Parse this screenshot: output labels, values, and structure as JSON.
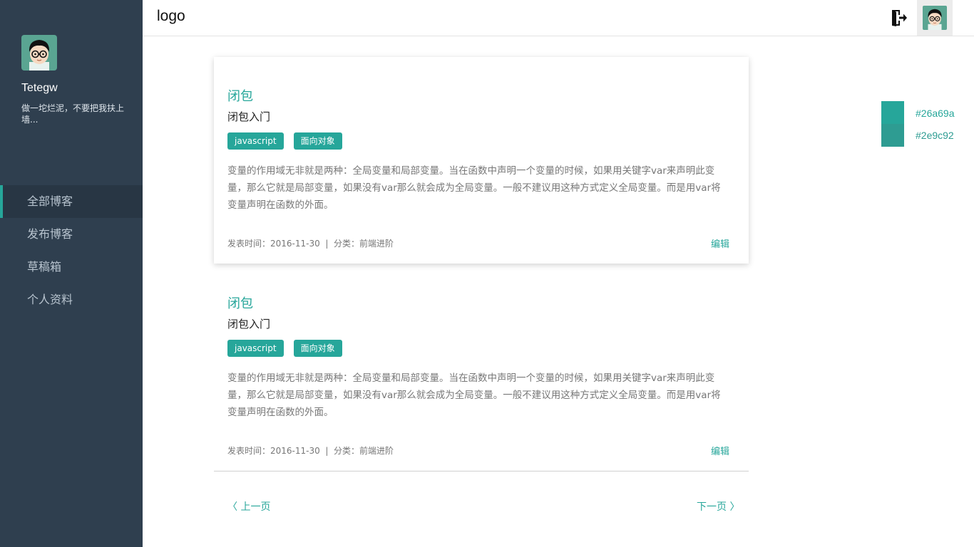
{
  "sidebar": {
    "name": "Tetegw",
    "motto": "做一坨烂泥，不要把我扶上墙...",
    "items": [
      {
        "label": "全部博客"
      },
      {
        "label": "发布博客"
      },
      {
        "label": "草稿箱"
      },
      {
        "label": "个人资料"
      }
    ]
  },
  "header": {
    "logo": "logo"
  },
  "articles": [
    {
      "title": "闭包",
      "subtitle": "闭包入门",
      "tags": [
        "javascript",
        "面向对象"
      ],
      "body": "变量的作用域无非就是两种：全局变量和局部变量。当在函数中声明一个变量的时候，如果用关键字var来声明此变量，那么它就是局部变量，如果没有var那么就会成为全局变量。一般不建议用这种方式定义全局变量。而是用var将变量声明在函数的外面。",
      "meta": "发表时间：2016-11-30  |  分类：前端进阶",
      "edit": "编辑"
    },
    {
      "title": "闭包",
      "subtitle": "闭包入门",
      "tags": [
        "javascript",
        "面向对象"
      ],
      "body": "变量的作用域无非就是两种：全局变量和局部变量。当在函数中声明一个变量的时候，如果用关键字var来声明此变量，那么它就是局部变量，如果没有var那么就会成为全局变量。一般不建议用这种方式定义全局变量。而是用var将变量声明在函数的外面。",
      "meta": "发表时间：2016-11-30  |  分类：前端进阶",
      "edit": "编辑"
    }
  ],
  "pager": {
    "prev": "〈 上一页",
    "next": "下一页 〉"
  },
  "theme": {
    "swatches": [
      {
        "label": "#26a69a",
        "color": "#26a69a"
      },
      {
        "label": "#2e9c92",
        "color": "#2e9c92"
      }
    ]
  },
  "colors": {
    "sidebar": "#2f3f4f",
    "accent": "#26a69a"
  }
}
